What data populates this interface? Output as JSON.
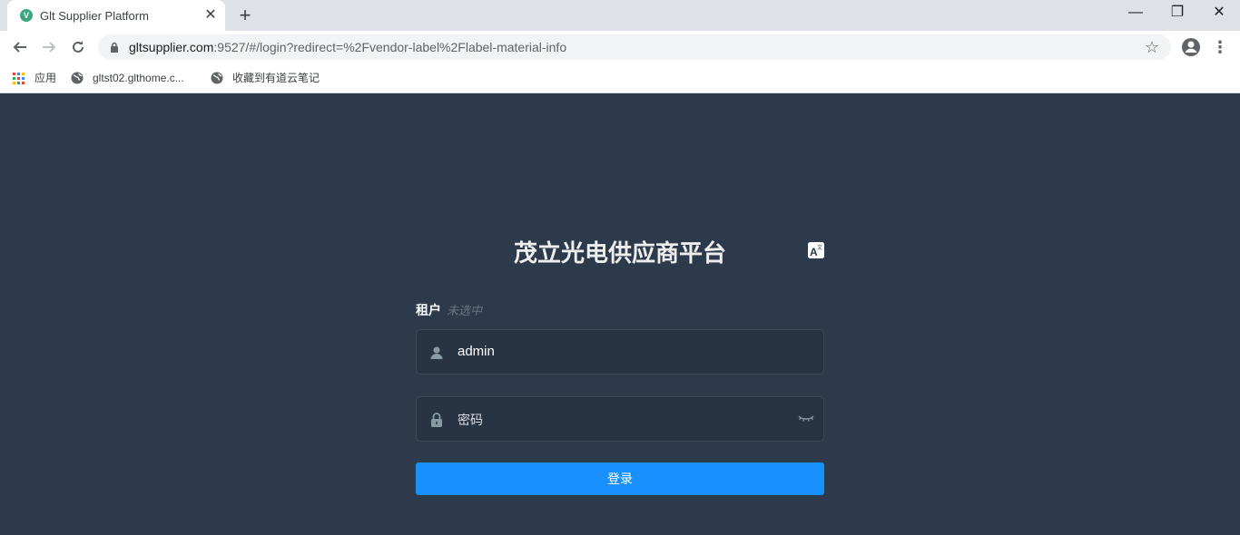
{
  "browser": {
    "tab_title": "Glt Supplier Platform",
    "tab_close": "✕",
    "new_tab": "+",
    "window_controls": {
      "minimize": "—",
      "maximize": "❐",
      "close": "✕"
    },
    "url_host": "gltsupplier.com",
    "url_rest": ":9527/#/login?redirect=%2Fvendor-label%2Flabel-material-info",
    "bookmarks": [
      {
        "label": "应用",
        "icon": "apps-grid-icon"
      },
      {
        "label": "gltst02.glthome.c...",
        "icon": "globe-icon"
      },
      {
        "label": "收藏到有道云笔记",
        "icon": "globe-icon"
      }
    ]
  },
  "login": {
    "title": "茂立光电供应商平台",
    "tenant_label": "租户",
    "tenant_value": "未选中",
    "username_value": "admin",
    "password_placeholder": "密码",
    "submit_label": "登录"
  },
  "colors": {
    "page_background": "#2d3a4b",
    "input_background": "#283443",
    "primary_button": "#1890ff"
  }
}
